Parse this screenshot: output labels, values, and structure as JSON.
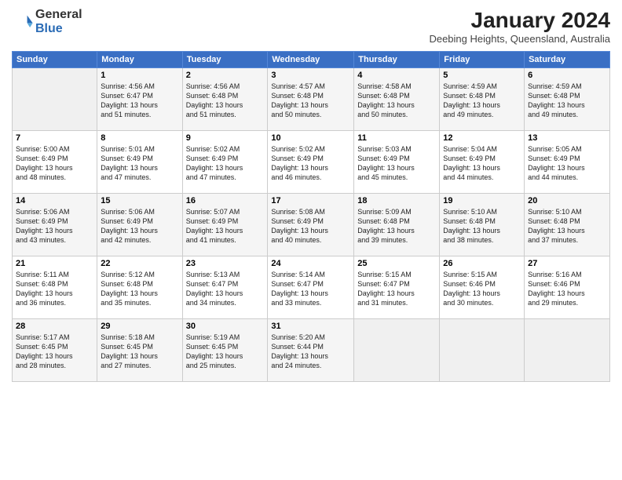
{
  "logo": {
    "general": "General",
    "blue": "Blue"
  },
  "header": {
    "month_year": "January 2024",
    "location": "Deebing Heights, Queensland, Australia"
  },
  "columns": [
    "Sunday",
    "Monday",
    "Tuesday",
    "Wednesday",
    "Thursday",
    "Friday",
    "Saturday"
  ],
  "weeks": [
    [
      {
        "day": "",
        "content": ""
      },
      {
        "day": "1",
        "content": "Sunrise: 4:56 AM\nSunset: 6:47 PM\nDaylight: 13 hours\nand 51 minutes."
      },
      {
        "day": "2",
        "content": "Sunrise: 4:56 AM\nSunset: 6:48 PM\nDaylight: 13 hours\nand 51 minutes."
      },
      {
        "day": "3",
        "content": "Sunrise: 4:57 AM\nSunset: 6:48 PM\nDaylight: 13 hours\nand 50 minutes."
      },
      {
        "day": "4",
        "content": "Sunrise: 4:58 AM\nSunset: 6:48 PM\nDaylight: 13 hours\nand 50 minutes."
      },
      {
        "day": "5",
        "content": "Sunrise: 4:59 AM\nSunset: 6:48 PM\nDaylight: 13 hours\nand 49 minutes."
      },
      {
        "day": "6",
        "content": "Sunrise: 4:59 AM\nSunset: 6:48 PM\nDaylight: 13 hours\nand 49 minutes."
      }
    ],
    [
      {
        "day": "7",
        "content": "Sunrise: 5:00 AM\nSunset: 6:49 PM\nDaylight: 13 hours\nand 48 minutes."
      },
      {
        "day": "8",
        "content": "Sunrise: 5:01 AM\nSunset: 6:49 PM\nDaylight: 13 hours\nand 47 minutes."
      },
      {
        "day": "9",
        "content": "Sunrise: 5:02 AM\nSunset: 6:49 PM\nDaylight: 13 hours\nand 47 minutes."
      },
      {
        "day": "10",
        "content": "Sunrise: 5:02 AM\nSunset: 6:49 PM\nDaylight: 13 hours\nand 46 minutes."
      },
      {
        "day": "11",
        "content": "Sunrise: 5:03 AM\nSunset: 6:49 PM\nDaylight: 13 hours\nand 45 minutes."
      },
      {
        "day": "12",
        "content": "Sunrise: 5:04 AM\nSunset: 6:49 PM\nDaylight: 13 hours\nand 44 minutes."
      },
      {
        "day": "13",
        "content": "Sunrise: 5:05 AM\nSunset: 6:49 PM\nDaylight: 13 hours\nand 44 minutes."
      }
    ],
    [
      {
        "day": "14",
        "content": "Sunrise: 5:06 AM\nSunset: 6:49 PM\nDaylight: 13 hours\nand 43 minutes."
      },
      {
        "day": "15",
        "content": "Sunrise: 5:06 AM\nSunset: 6:49 PM\nDaylight: 13 hours\nand 42 minutes."
      },
      {
        "day": "16",
        "content": "Sunrise: 5:07 AM\nSunset: 6:49 PM\nDaylight: 13 hours\nand 41 minutes."
      },
      {
        "day": "17",
        "content": "Sunrise: 5:08 AM\nSunset: 6:49 PM\nDaylight: 13 hours\nand 40 minutes."
      },
      {
        "day": "18",
        "content": "Sunrise: 5:09 AM\nSunset: 6:48 PM\nDaylight: 13 hours\nand 39 minutes."
      },
      {
        "day": "19",
        "content": "Sunrise: 5:10 AM\nSunset: 6:48 PM\nDaylight: 13 hours\nand 38 minutes."
      },
      {
        "day": "20",
        "content": "Sunrise: 5:10 AM\nSunset: 6:48 PM\nDaylight: 13 hours\nand 37 minutes."
      }
    ],
    [
      {
        "day": "21",
        "content": "Sunrise: 5:11 AM\nSunset: 6:48 PM\nDaylight: 13 hours\nand 36 minutes."
      },
      {
        "day": "22",
        "content": "Sunrise: 5:12 AM\nSunset: 6:48 PM\nDaylight: 13 hours\nand 35 minutes."
      },
      {
        "day": "23",
        "content": "Sunrise: 5:13 AM\nSunset: 6:47 PM\nDaylight: 13 hours\nand 34 minutes."
      },
      {
        "day": "24",
        "content": "Sunrise: 5:14 AM\nSunset: 6:47 PM\nDaylight: 13 hours\nand 33 minutes."
      },
      {
        "day": "25",
        "content": "Sunrise: 5:15 AM\nSunset: 6:47 PM\nDaylight: 13 hours\nand 31 minutes."
      },
      {
        "day": "26",
        "content": "Sunrise: 5:15 AM\nSunset: 6:46 PM\nDaylight: 13 hours\nand 30 minutes."
      },
      {
        "day": "27",
        "content": "Sunrise: 5:16 AM\nSunset: 6:46 PM\nDaylight: 13 hours\nand 29 minutes."
      }
    ],
    [
      {
        "day": "28",
        "content": "Sunrise: 5:17 AM\nSunset: 6:45 PM\nDaylight: 13 hours\nand 28 minutes."
      },
      {
        "day": "29",
        "content": "Sunrise: 5:18 AM\nSunset: 6:45 PM\nDaylight: 13 hours\nand 27 minutes."
      },
      {
        "day": "30",
        "content": "Sunrise: 5:19 AM\nSunset: 6:45 PM\nDaylight: 13 hours\nand 25 minutes."
      },
      {
        "day": "31",
        "content": "Sunrise: 5:20 AM\nSunset: 6:44 PM\nDaylight: 13 hours\nand 24 minutes."
      },
      {
        "day": "",
        "content": ""
      },
      {
        "day": "",
        "content": ""
      },
      {
        "day": "",
        "content": ""
      }
    ]
  ]
}
